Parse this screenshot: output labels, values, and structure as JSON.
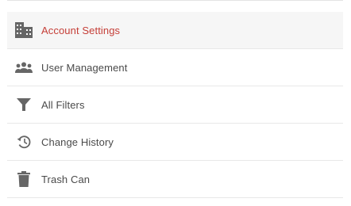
{
  "admin_menu": {
    "items": [
      {
        "label": "Account Settings",
        "icon": "building-icon",
        "active": true
      },
      {
        "label": "User Management",
        "icon": "people-group-icon",
        "active": false
      },
      {
        "label": "All Filters",
        "icon": "filter-funnel-icon",
        "active": false
      },
      {
        "label": "Change History",
        "icon": "history-clock-icon",
        "active": false
      },
      {
        "label": "Trash Can",
        "icon": "trash-can-icon",
        "active": false
      }
    ]
  },
  "colors": {
    "active_text": "#c53e37",
    "default_text": "#4a4a4a",
    "icon": "#666666",
    "active_background": "#f6f6f6",
    "divider": "#e8e8e8"
  }
}
